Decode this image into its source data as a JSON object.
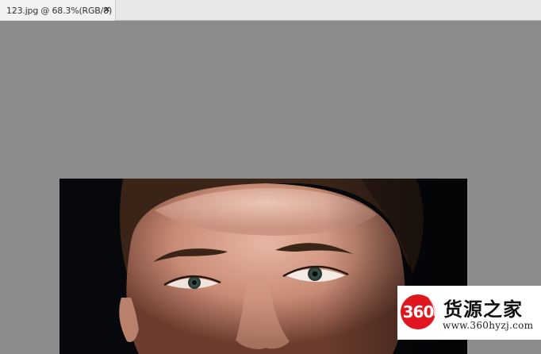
{
  "document_tab": {
    "title": "123.jpg @ 68.3%(RGB/8)",
    "close_glyph": "×",
    "close_icon": "close-icon"
  },
  "canvas": {
    "background_color": "#8c8c8c",
    "image_description": "close-up portrait photo of a woman's face on a dark background"
  },
  "watermark": {
    "logo_text": "360",
    "logo_color": "#e0151d",
    "brand": "货源之家",
    "url": "www.360hyzj.com"
  }
}
